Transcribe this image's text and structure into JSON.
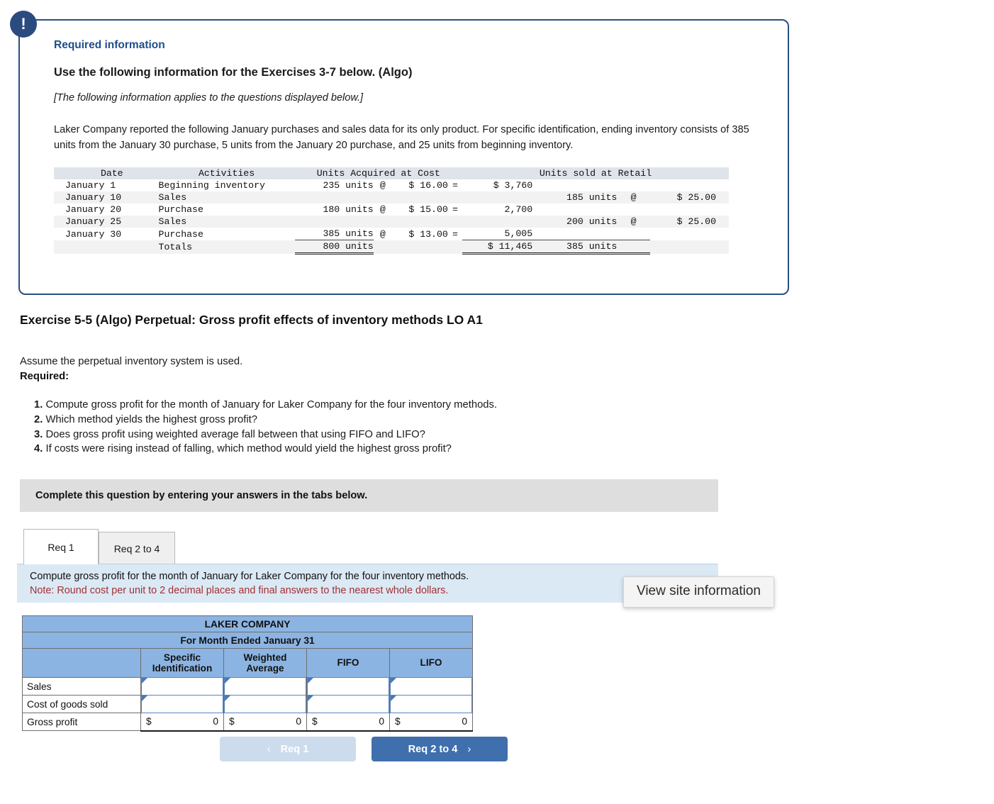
{
  "alert_icon": "exclamation-icon",
  "required_info": {
    "link_label": "Required information",
    "heading": "Use the following information for the Exercises 3-7 below. (Algo)",
    "italic_note": "[The following information applies to the questions displayed below.]",
    "body": "Laker Company reported the following January purchases and sales data for its only product. For specific identification, ending inventory consists of 385 units from the January 30 purchase, 5 units from the January 20 purchase, and 25 units from beginning inventory."
  },
  "data_table": {
    "headers": {
      "date": "Date",
      "activities": "Activities",
      "acquired": "Units Acquired at Cost",
      "sold": "Units sold at Retail"
    },
    "rows": [
      {
        "date": "January 1",
        "activity": "Beginning inventory",
        "units": "235 units",
        "at": "@",
        "price": "$ 16.00",
        "eq": "=",
        "ext": "$ 3,760",
        "sold_units": "",
        "sold_at": "",
        "sold_price": ""
      },
      {
        "date": "January 10",
        "activity": "Sales",
        "units": "",
        "at": "",
        "price": "",
        "eq": "",
        "ext": "",
        "sold_units": "185 units",
        "sold_at": "@",
        "sold_price": "$ 25.00"
      },
      {
        "date": "January 20",
        "activity": "Purchase",
        "units": "180 units",
        "at": "@",
        "price": "$ 15.00",
        "eq": "=",
        "ext": "2,700",
        "sold_units": "",
        "sold_at": "",
        "sold_price": ""
      },
      {
        "date": "January 25",
        "activity": "Sales",
        "units": "",
        "at": "",
        "price": "",
        "eq": "",
        "ext": "",
        "sold_units": "200 units",
        "sold_at": "@",
        "sold_price": "$ 25.00"
      },
      {
        "date": "January 30",
        "activity": "Purchase",
        "units": "385 units",
        "at": "@",
        "price": "$ 13.00",
        "eq": "=",
        "ext": "5,005",
        "sold_units": "",
        "sold_at": "",
        "sold_price": ""
      }
    ],
    "totals": {
      "date": "",
      "activity": "Totals",
      "units": "800 units",
      "at": "",
      "price": "",
      "eq": "",
      "ext": "$ 11,465",
      "sold_units": "385 units",
      "sold_at": "",
      "sold_price": ""
    }
  },
  "exercise": {
    "title": "Exercise 5-5 (Algo) Perpetual: Gross profit effects of inventory methods LO A1",
    "assume": "Assume the perpetual inventory system is used.",
    "required_label": "Required:",
    "items": [
      {
        "num": "1.",
        "text": "Compute gross profit for the month of January for Laker Company for the four inventory methods."
      },
      {
        "num": "2.",
        "text": "Which method yields the highest gross profit?"
      },
      {
        "num": "3.",
        "text": "Does gross profit using weighted average fall between that using FIFO and LIFO?"
      },
      {
        "num": "4.",
        "text": "If costs were rising instead of falling, which method would yield the highest gross profit?"
      }
    ]
  },
  "complete_banner": "Complete this question by entering your answers in the tabs below.",
  "tabs": [
    {
      "label": "Req 1",
      "active": true
    },
    {
      "label": "Req 2 to 4",
      "active": false
    }
  ],
  "instruction": {
    "line1": "Compute gross profit for the month of January for Laker Company for the four inventory methods.",
    "line2": "Note: Round cost per unit to 2 decimal places and final answers to the nearest whole dollars."
  },
  "answer_table": {
    "company": "LAKER COMPANY",
    "period": "For Month Ended January 31",
    "columns": [
      "Specific Identification",
      "Weighted Average",
      "FIFO",
      "LIFO"
    ],
    "column_lines": [
      [
        "Specific",
        "Identification"
      ],
      [
        "Weighted",
        "Average"
      ],
      [
        "FIFO",
        ""
      ],
      [
        "LIFO",
        ""
      ]
    ],
    "rows": [
      {
        "label": "Sales",
        "type": "input",
        "values": [
          "",
          "",
          "",
          ""
        ]
      },
      {
        "label": "Cost of goods sold",
        "type": "input",
        "values": [
          "",
          "",
          "",
          ""
        ]
      },
      {
        "label": "Gross profit",
        "type": "total",
        "currency": "$",
        "values": [
          "0",
          "0",
          "0",
          "0"
        ]
      }
    ]
  },
  "nav": {
    "prev_label": "Req 1",
    "next_label": "Req 2 to 4",
    "prev_chevron": "‹",
    "next_chevron": "›"
  },
  "tooltip": "View site information",
  "colors": {
    "accent_navy": "#2a4b80",
    "link_blue": "#1f4e8c",
    "table_header_blue": "#8cb4e2",
    "instruction_band": "#dbe9f5",
    "note_red": "#a33030",
    "button_blue": "#3f6fad",
    "button_disabled": "#ccdcec",
    "banner_grey": "#dedede"
  }
}
